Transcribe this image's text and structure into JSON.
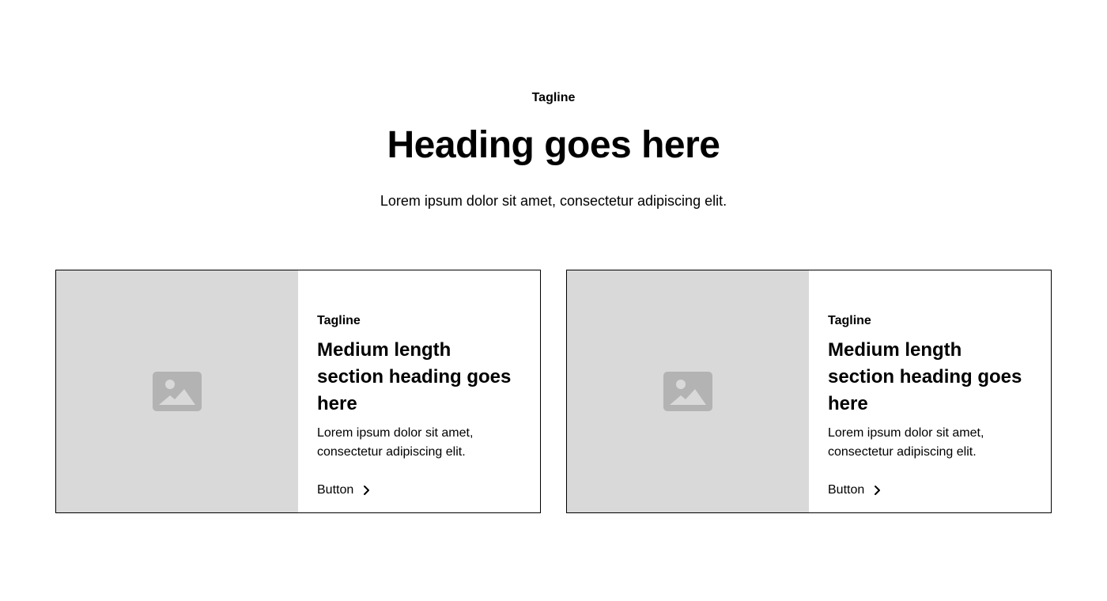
{
  "header": {
    "tagline": "Tagline",
    "heading": "Heading goes here",
    "text": "Lorem ipsum dolor sit amet, consectetur adipiscing elit."
  },
  "cards": [
    {
      "tagline": "Tagline",
      "heading": "Medium length section heading goes here",
      "text": "Lorem ipsum dolor sit amet, consectetur adipiscing elit.",
      "button_label": "Button",
      "image_icon": "image-placeholder-icon",
      "button_icon": "chevron-right-icon"
    },
    {
      "tagline": "Tagline",
      "heading": "Medium length section heading goes here",
      "text": "Lorem ipsum dolor sit amet, consectetur adipiscing elit.",
      "button_label": "Button",
      "image_icon": "image-placeholder-icon",
      "button_icon": "chevron-right-icon"
    }
  ],
  "colors": {
    "image_placeholder_bg": "#d9d9d9",
    "image_icon": "#b3b3b3",
    "border": "#000000",
    "text": "#000000"
  }
}
